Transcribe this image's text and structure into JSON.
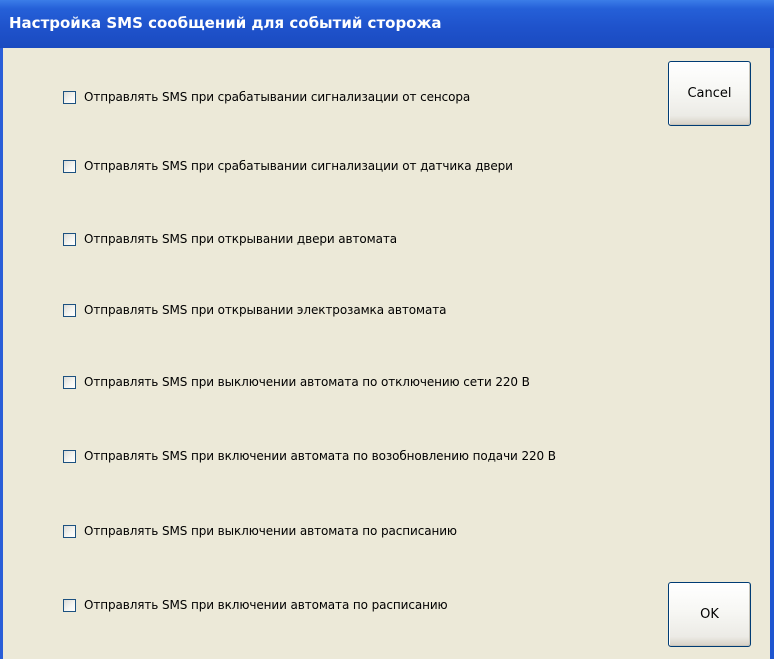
{
  "window": {
    "title": "Настройка SMS сообщений для событий сторожа"
  },
  "options": [
    {
      "label": "Отправлять SMS при срабатывании сигнализации от сенсора",
      "checked": false
    },
    {
      "label": "Отправлять SMS при срабатывании сигнализации от датчика двери",
      "checked": false
    },
    {
      "label": "Отправлять SMS при открывании двери автомата",
      "checked": false
    },
    {
      "label": "Отправлять SMS при открывании электрозамка автомата",
      "checked": false
    },
    {
      "label": "Отправлять SMS при выключении автомата по отключению сети 220 В",
      "checked": false
    },
    {
      "label": "Отправлять SMS при включении автомата по возобновлению подачи  220 В",
      "checked": false
    },
    {
      "label": "Отправлять SMS при выключении автомата по расписанию",
      "checked": false
    },
    {
      "label": "Отправлять SMS при включении автомата по расписанию",
      "checked": false
    }
  ],
  "buttons": {
    "cancel": "Cancel",
    "ok": "OK"
  },
  "colors": {
    "titlebar": "#1F53CC",
    "title_text": "#FFFFFF",
    "dialog_bg": "#ECE9D8",
    "checkbox_border": "#1C5180",
    "button_border": "#003C74"
  }
}
